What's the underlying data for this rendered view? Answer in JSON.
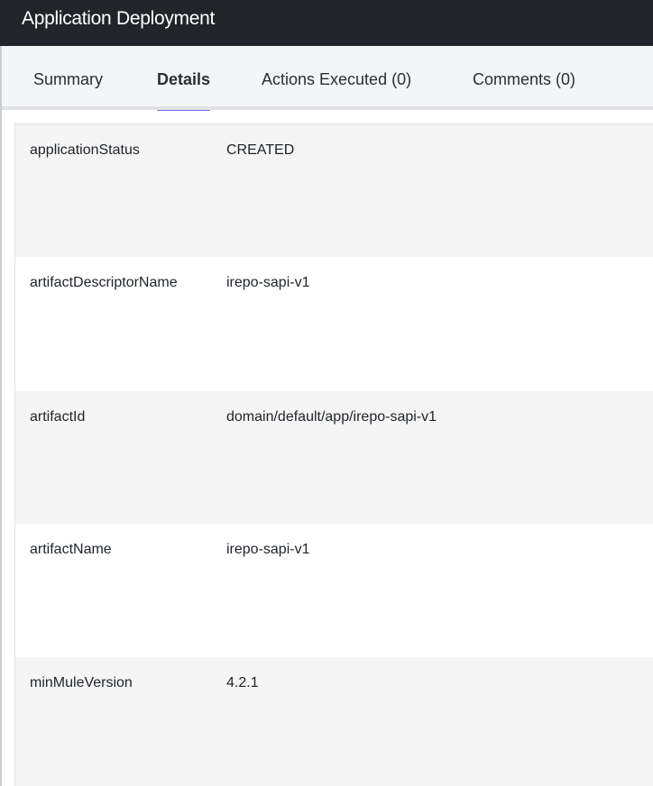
{
  "window": {
    "title": "Application Deployment"
  },
  "tabs": [
    {
      "label": "Summary",
      "active": false
    },
    {
      "label": "Details",
      "active": true
    },
    {
      "label": "Actions Executed (0)",
      "active": false
    },
    {
      "label": "Comments (0)",
      "active": false
    }
  ],
  "details": [
    {
      "key": "applicationStatus",
      "value": "CREATED"
    },
    {
      "key": "artifactDescriptorName",
      "value": "irepo-sapi-v1"
    },
    {
      "key": "artifactId",
      "value": "domain/default/app/irepo-sapi-v1"
    },
    {
      "key": "artifactName",
      "value": "irepo-sapi-v1"
    },
    {
      "key": "minMuleVersion",
      "value": "4.2.1"
    }
  ],
  "colors": {
    "titlebar_bg": "#21252b",
    "tab_active_indicator": "#7b6cd9",
    "row_shaded_bg": "#f5f5f5"
  }
}
